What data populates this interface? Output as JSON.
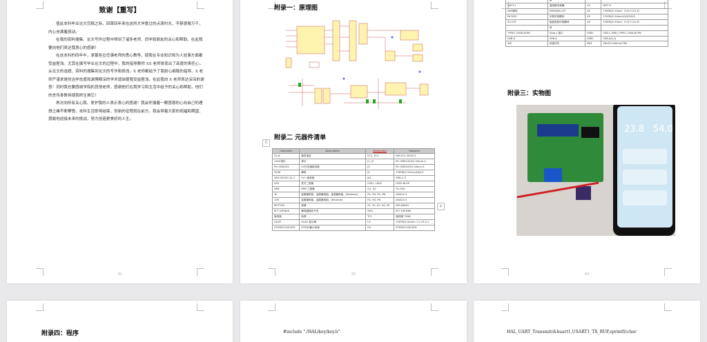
{
  "pages": [
    {
      "number": "41"
    },
    {
      "number": "42"
    },
    {
      "number": "43"
    }
  ],
  "ack": {
    "title": "致谢【重写】",
    "paragraphs": [
      "值此本科毕业论文完稿之际，回首四年来在这所大学度过的点滴时光，不禁感慨万千，内心充满着感动。",
      "在我的资料搜集、论文写作过程中得到了诸多老师、同学和朋友的关心和帮助，在此我要向他们表达我衷心的感谢！",
      "在这本科的四年中，承蒙各位任课老师的悉心教导，使我在专业知识和为人处事方面都受益匪浅。尤其在撰写毕业论文的过程中，我的指导教师 XX 老师体现出了高度的责任心，从论文的选题、资料的搜集到论文的写作和修改，X 老师都给予了我耐心细致的指导。X 老师严谨求是的治学态度和渊博精深的学术造诣使我受益匪浅，在此我向 X 老师表达深深的谢意！同时我也要感谢学院的其他老师，感谢他们在我学习和生活中给予的关心和帮助，他们的言传身教将使我终生难忘！",
      "再次向所有关心我、爱护我的人表示衷心的感谢！我会怀揣着一颗感恩的心向自己的理想之峰不断攀登。本科生活即将结束，但新的征程就在前方，我会带着大家的祝福和期望，勇敢地迎接未来的挑战，努力创造更美好的人生。"
    ]
  },
  "appendix1": {
    "title": "附录一：原理图"
  },
  "appendix2": {
    "title": "附录二  元器件清单",
    "headers": [
      "Comment",
      "Description",
      "Designator",
      "Footprint"
    ],
    "rows": [
      [
        "22uF",
        "极性电容",
        "EC1, EC2",
        "DIP-EC2.5X5X11"
      ],
      [
        "1X20排针",
        "排针",
        "J1, J2",
        "Pin HDR1X20/2.54mm-S"
      ],
      [
        "Pin HDR2X3",
        "5V升压通用电源",
        "J3",
        "Pin HDR2X3/2.54mm-S"
      ],
      [
        "5096",
        "蜂鸣",
        "J4",
        "1*6PIN/2.54mm/DJ/V.0"
      ],
      [
        "SRD-05VDC-SL-C",
        "5V一组转换",
        "JK1",
        "SRD-C-P"
      ],
      [
        "LED",
        "发光二极管",
        "LED1, LED2",
        "LED5-BLUE"
      ],
      [
        "NPN",
        "NPN 三极管",
        "Q1, Q2",
        "TO-92A"
      ],
      [
        "1K",
        "金属膜电阻，金属膜电阻，金属膜电阻，[BsValue]",
        "R1, R4, R5, R6",
        "AXIAL0.3"
      ],
      [
        "10K",
        "金属膜电阻，金属膜电阻，[BsValue]",
        "R2, R3, R9",
        "AXIAL0.3"
      ],
      [
        "BUTTON",
        "按键",
        "S1, S2, S3, S4, S5",
        "DIP-6X6X5"
      ],
      [
        "KF7 DIP-BK6",
        "蜂鸣器插件开关",
        "SW1",
        "KF7 DIP-BK6"
      ],
      [
        "接线端",
        "电源",
        "TC1",
        "接线端 T3HB"
      ],
      [
        "OLED",
        "OLED 显示屏",
        "U1",
        "1*4PIN/2.54mm 1.0 V3.5.1"
      ],
      [
        "STM32F103C8T6",
        "STM32最小系统",
        "U2",
        "STM32F103C8T6"
      ]
    ]
  },
  "page3_table": {
    "rows": [
      [
        "",
        "模",
        "",
        ""
      ],
      [
        "DHT11",
        "温湿度传感器",
        "U3",
        "DHT11"
      ],
      [
        "WiFi模块",
        "ESP8266-12F",
        "U4",
        "1*6PIN/2.54mm（S.R.T.G.K.E）"
      ],
      [
        "PA7620",
        "手势识别模块",
        "U5",
        "1*5PIN/2.54mm/G/S/S/S/S"
      ],
      [
        "SU-03T",
        "智能语音识别模块",
        "U6",
        "1*8PIN/2.54mm（S.R.T.G.K.E）"
      ],
      [
        "",
        "块",
        "",
        ""
      ],
      [
        "TYPEC-250B-6CPN",
        "Type-c 接口",
        "USB1",
        "USB-C-SMD_TYPEC-250B-6CPN"
      ],
      [
        "USB-A",
        "USB-A",
        "USB2",
        "USB-A/S_A"
      ],
      [
        "XI6",
        "自锁开关",
        "SW1",
        "SW-D3.5x6mm/T80"
      ]
    ]
  },
  "appendix3": {
    "title": "附录三：实物图"
  },
  "photo": {
    "temp": "23.8",
    "humi": "54.0"
  },
  "appendix4": {
    "title": "附录四：程序"
  },
  "code": {
    "line1": "#include \"./HAL/key/key.h\"",
    "line2": "HAL_UART_Transmit(&huart1,USART1_TX_BUF,sprintf((char"
  },
  "controls": {
    "add": "+",
    "handle": "⠿"
  },
  "colors": {
    "board": "#2f8a3a",
    "phoneScreen": "#cfe7f4",
    "schematic": "#d9a400"
  }
}
